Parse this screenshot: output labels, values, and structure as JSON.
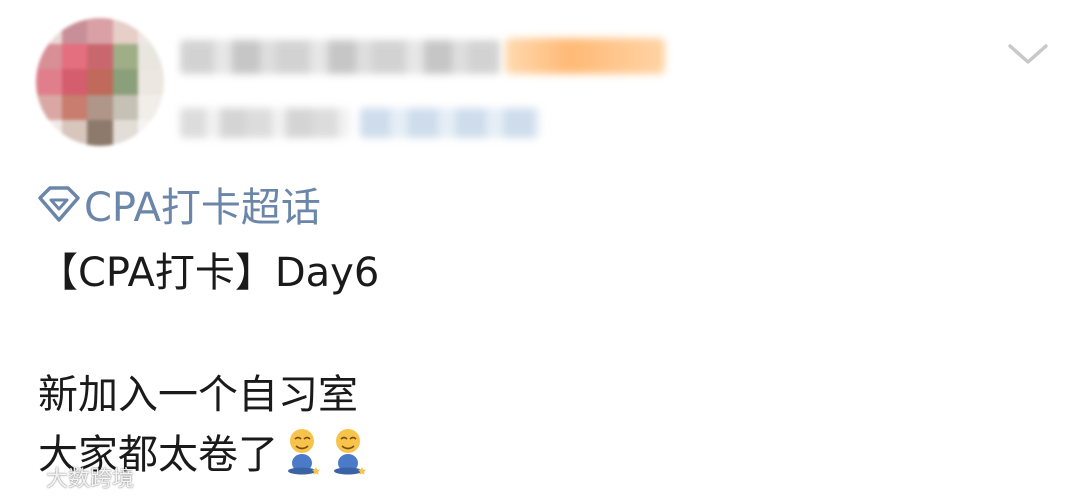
{
  "post": {
    "topic": "CPA打卡超话",
    "title_line": "【CPA打卡】Day6",
    "body_line_1": "新加入一个自习室",
    "body_line_2": "大家都太卷了",
    "emojis": [
      "sitting-smiling-emoji",
      "sitting-smiling-emoji"
    ]
  },
  "icons": {
    "topic_icon": "diamond-icon",
    "menu_icon": "chevron-down-icon"
  },
  "watermark": {
    "text": "大数跨境"
  },
  "colors": {
    "topic_link": "#6b86a8",
    "text": "#1a1a1a",
    "chevron": "#c8c8c8",
    "badge": "#ffb268"
  }
}
